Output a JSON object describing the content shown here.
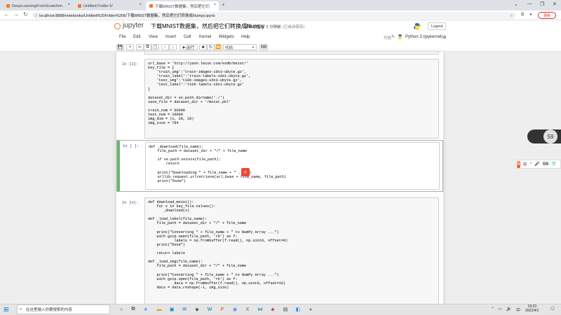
{
  "browser": {
    "tabs": [
      {
        "title": "DeepLearningFromScratch/m",
        "active": false
      },
      {
        "title": "Untitled Folder 6/",
        "active": false
      },
      {
        "title": "下载MNIST数据集，然后把它们",
        "active": true
      }
    ],
    "new_tab": "+",
    "url": "localhost:8888/notebooks/Untitled%20Folder%206/下载MNIST数据集，然后把它们转换成Numpy.ipynb",
    "update_label": "更新"
  },
  "jupyter": {
    "logo_word": "jupyter",
    "notebook_name": "下载MNIST数据集，然后把它们转换成Numpy",
    "checkpoint": "最新检查点: 2 分钟前",
    "autosave": "(已自动保存)",
    "logout": "Logout",
    "menu": [
      "File",
      "Edit",
      "View",
      "Insert",
      "Cell",
      "Kernel",
      "Widgets",
      "Help"
    ],
    "trusted": "可信",
    "kernel": "Python 3 (ipykernel)",
    "run_label": "运行",
    "cell_type": "代码"
  },
  "cells": [
    {
      "prompt": "In [3]:",
      "code": "url_base = 'http://yann.lecun.com/exdb/mnist/'\nkey_file = {\n    'train_img':'train-images-idx3-ubyte.gz',\n    'train_label':'train-labels-idx1-ubyte.gz',\n    'test_img':'t10k-images-idx3-ubyte.gz',\n    'test_label':'t10k-labels-idx1-ubyte.gz'\n}\n\ndataset_dir = os.path.dirname('./')\nsave_file = dataset_dir + '/mnist.pkl'\n\ntrain_num = 60000\ntest_num = 10000\nimg_dim = (1, 28, 28)\nimg_size = 784"
    },
    {
      "prompt": "In [ ]:",
      "code": "def _download(file_name):\n    file_path = dataset_dir + \"/\" + file_name\n\n    if os.path.exists(file_path):\n        return\n\n    print(\"Downloading \" + file_name + \" ... \")\n    urllib.request.urlretrieve(url_base + file_name, file_path)\n    print(\"Done\")"
    },
    {
      "prompt": "In [4]:",
      "code": "def download_mnist():\n    for v in key_file.values():\n       _download(v)\n\ndef _load_label(file_name):\n    file_path = dataset_dir + \"/\" + file_name\n\n    print(\"Converting \" + file_name + \" to NumPy Array ...\")\n    with gzip.open(file_path, 'rb') as f:\n            labels = np.frombuffer(f.read(), np.uint8, offset=8)\n    print(\"Done\")\n\n    return labels\n\ndef _load_img(file_name):\n    file_path = dataset_dir + \"/\" + file_name\n\n    print(\"Converting \" + file_name + \" to NumPy Array ...\")\n    with gzip.open(file_path, 'rb') as f:\n            data = np.frombuffer(f.read(), np.uint8, offset=16)\n    data = data.reshape(-1, img_size)"
    }
  ],
  "overlay": {
    "speed_value": "59",
    "ime_label": "中"
  },
  "taskbar": {
    "search_placeholder": "在这里输入你要搜索的内容",
    "time": "19:23",
    "date": "2022/4/1",
    "tray_lang": "中"
  }
}
